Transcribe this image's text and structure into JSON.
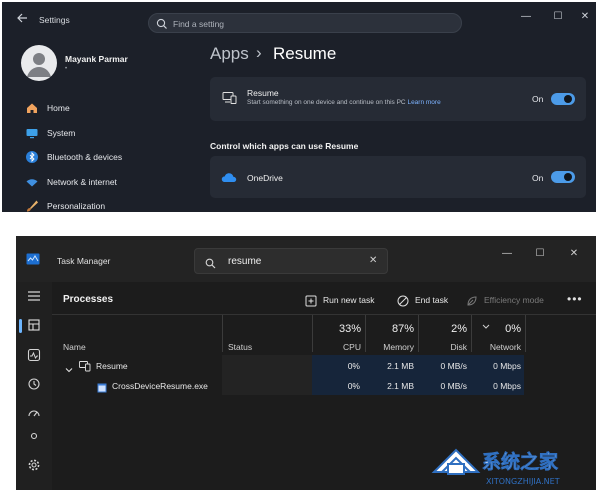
{
  "settings": {
    "app_title": "Settings",
    "search_placeholder": "Find a setting",
    "user": {
      "name": "Mayank Parmar",
      "sub": "•"
    },
    "nav": [
      {
        "label": "Home",
        "icon": "home-icon"
      },
      {
        "label": "System",
        "icon": "system-icon"
      },
      {
        "label": "Bluetooth & devices",
        "icon": "bluetooth-icon"
      },
      {
        "label": "Network & internet",
        "icon": "wifi-icon"
      },
      {
        "label": "Personalization",
        "icon": "brush-icon"
      }
    ],
    "breadcrumb": {
      "parent": "Apps",
      "separator": "›",
      "current": "Resume"
    },
    "resume_card": {
      "title": "Resume",
      "description": "Start something on one device and continue on this PC",
      "link": "Learn more",
      "state": "On",
      "enabled": true
    },
    "section_title": "Control which apps can use Resume",
    "onedrive_card": {
      "title": "OneDrive",
      "state": "On",
      "enabled": true
    },
    "window_controls": {
      "minimize": "—",
      "maximize": "☐",
      "close": "✕"
    }
  },
  "task_manager": {
    "title": "Task Manager",
    "search_value": "resume",
    "search_clear": "✕",
    "window_controls": {
      "minimize": "—",
      "maximize": "☐",
      "close": "✕"
    },
    "page_title": "Processes",
    "toolbar": {
      "run_new_task": "Run new task",
      "end_task": "End task",
      "efficiency_mode": "Efficiency mode",
      "more": "•••"
    },
    "columns": {
      "name": "Name",
      "status": "Status",
      "cpu": {
        "pct": "33%",
        "label": "CPU"
      },
      "memory": {
        "pct": "87%",
        "label": "Memory"
      },
      "disk": {
        "pct": "2%",
        "label": "Disk"
      },
      "network": {
        "pct": "0%",
        "label": "Network"
      }
    },
    "rows": [
      {
        "name": "Resume",
        "status": "",
        "cpu": "0%",
        "memory": "2.1 MB",
        "disk": "0 MB/s",
        "network": "0 Mbps",
        "expandable": true
      },
      {
        "name": "CrossDeviceResume.exe",
        "status": "",
        "cpu": "0%",
        "memory": "2.1 MB",
        "disk": "0 MB/s",
        "network": "0 Mbps",
        "expandable": false
      }
    ]
  },
  "watermark": {
    "text": "系统之家",
    "url": "XITONGZHIJIA.NET"
  },
  "colors": {
    "accent": "#4c9be8",
    "highlight": "#16253a"
  }
}
